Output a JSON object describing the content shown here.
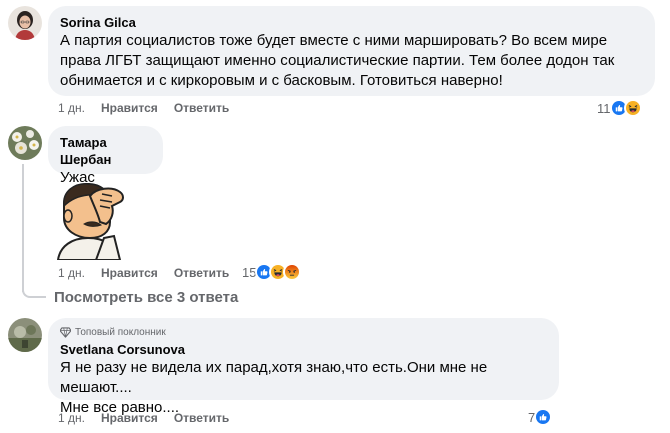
{
  "comments": [
    {
      "author": "Sorina Gilca",
      "lines": [
        "А партия социалистов тоже будет вместе с ними маршировать? Во всем мире",
        "права ЛГБТ защищают именно социалистические партии. Тем более додон так",
        "обнимается и с киркоровым и с басковым. Готовиться наверно!"
      ],
      "time": "1 дн.",
      "like_label": "Нравится",
      "reply_label": "Ответить",
      "reaction_count": "11",
      "reactions": [
        "like-icon",
        "haha-icon"
      ]
    },
    {
      "author": "Тамара Шербан",
      "lines": [
        "Ужас"
      ],
      "sticker": "facepalm-sticker",
      "time": "1 дн.",
      "like_label": "Нравится",
      "reply_label": "Ответить",
      "reaction_count": "15",
      "reactions": [
        "like-icon",
        "haha-icon",
        "angry-icon"
      ]
    },
    {
      "badge": "Топовый поклонник",
      "author": "Svetlana Corsunova",
      "lines": [
        "Я не разу не видела их парад,хотя знаю,что есть.Они мне не мешают....",
        "Мне все равно...."
      ],
      "time": "1 дн.",
      "like_label": "Нравится",
      "reply_label": "Ответить",
      "reaction_count": "7",
      "reactions": [
        "like-icon"
      ]
    }
  ],
  "view_replies": "Посмотреть все 3 ответа",
  "colors": {
    "like": "#1877f2",
    "haha": "#f7b125",
    "angry": "#e9710f",
    "bubble": "#f0f2f5",
    "meta": "#65676b"
  }
}
